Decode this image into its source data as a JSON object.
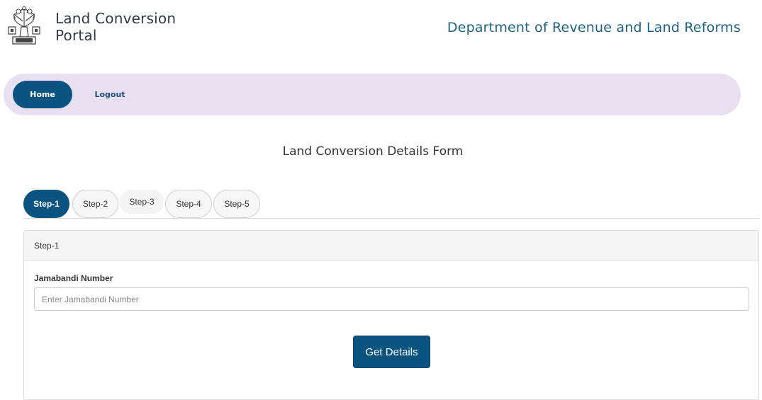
{
  "header": {
    "brand_line1": "Land Conversion",
    "brand_line2": "Portal",
    "department": "Department of Revenue and Land Reforms",
    "logo_icon": "bihar-emblem-icon"
  },
  "nav": {
    "home_label": "Home",
    "logout_label": "Logout"
  },
  "form": {
    "title": "Land Conversion Details Form",
    "tabs": [
      {
        "label": "Step-1",
        "active": true
      },
      {
        "label": "Step-2",
        "active": false
      },
      {
        "label": "Step-3",
        "active": false
      },
      {
        "label": "Step-4",
        "active": false
      },
      {
        "label": "Step-5",
        "active": false
      }
    ],
    "panel_heading": "Step-1",
    "jamabandi_label": "Jamabandi Number",
    "jamabandi_value": "",
    "jamabandi_placeholder": "Enter Jamabandi Number",
    "submit_label": "Get Details"
  },
  "colors": {
    "primary": "#0b5381",
    "nav_background": "#e8e0f1",
    "department_text": "#1f6282"
  }
}
